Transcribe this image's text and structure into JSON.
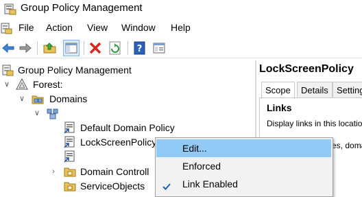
{
  "window": {
    "title": "Group Policy Management",
    "icon": "gpmc-app-icon"
  },
  "menubar": {
    "items": [
      "File",
      "Action",
      "View",
      "Window",
      "Help"
    ]
  },
  "toolbar": {
    "buttons": [
      "back-arrow-icon",
      "forward-arrow-icon",
      "up-folder-icon",
      "show-hide-tree-icon",
      "delete-icon",
      "refresh-icon",
      "help-icon",
      "properties-icon"
    ]
  },
  "tree": {
    "root": "Group Policy Management",
    "forest": "Forest:",
    "domains": "Domains",
    "domain": "",
    "items": [
      "Default Domain Policy",
      "LockScreenPolicy",
      "",
      "Domain Controll",
      "ServiceObjects"
    ]
  },
  "details": {
    "title": "LockScreenPolicy",
    "tabs": [
      "Scope",
      "Details",
      "Setting"
    ],
    "section": "Links",
    "text": "Display links in this locatio",
    "text2": "es, doma"
  },
  "context_menu": {
    "items": [
      {
        "label": "Edit...",
        "highlighted": true,
        "checked": false
      },
      {
        "label": "Enforced",
        "highlighted": false,
        "checked": false
      },
      {
        "label": "Link Enabled",
        "highlighted": false,
        "checked": true
      }
    ]
  },
  "colors": {
    "highlight": "#91c9f7",
    "menu_bg": "#f2f2f2",
    "check": "#1f5fb4"
  }
}
